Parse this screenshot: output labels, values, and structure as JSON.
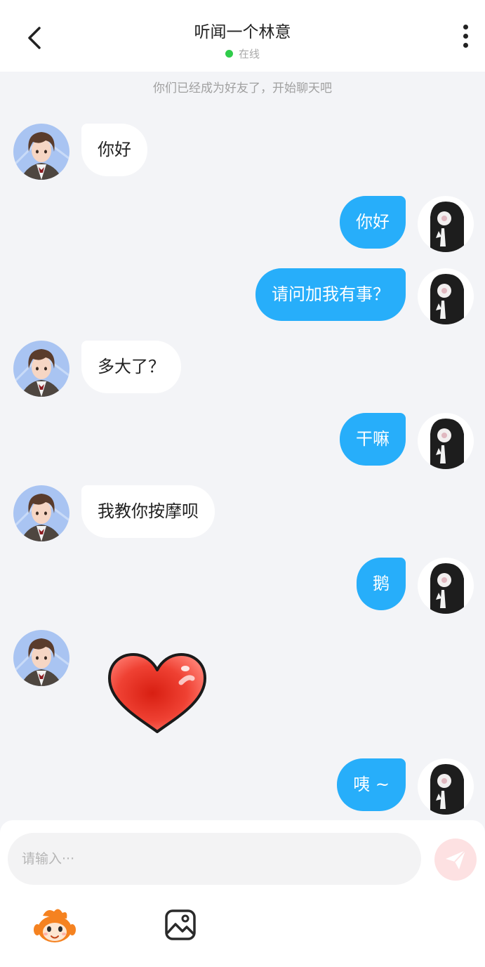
{
  "header": {
    "title": "听闻一个林意",
    "status": "在线"
  },
  "system_note": "你们已经成为好友了，开始聊天吧",
  "messages": [
    {
      "side": "left",
      "text": "你好"
    },
    {
      "side": "right",
      "text": "你好"
    },
    {
      "side": "right",
      "text": "请问加我有事？"
    },
    {
      "side": "left",
      "text": "多大了？"
    },
    {
      "side": "right",
      "text": "干嘛"
    },
    {
      "side": "left",
      "text": "我教你按摩呗"
    },
    {
      "side": "right",
      "text": "鹅"
    },
    {
      "side": "left",
      "sticker": "heart-sticker"
    },
    {
      "side": "right",
      "text": "咦 ~"
    }
  ],
  "input": {
    "placeholder": "请输入···"
  },
  "colors": {
    "accent": "#27aefa",
    "online": "#2fcc4a",
    "send_button": "#fde1e2"
  },
  "icons": {
    "back": "chevron-left-icon",
    "more": "more-vertical-icon",
    "send": "paper-plane-icon",
    "emoji": "emoji-sticker-icon",
    "image": "image-icon"
  }
}
